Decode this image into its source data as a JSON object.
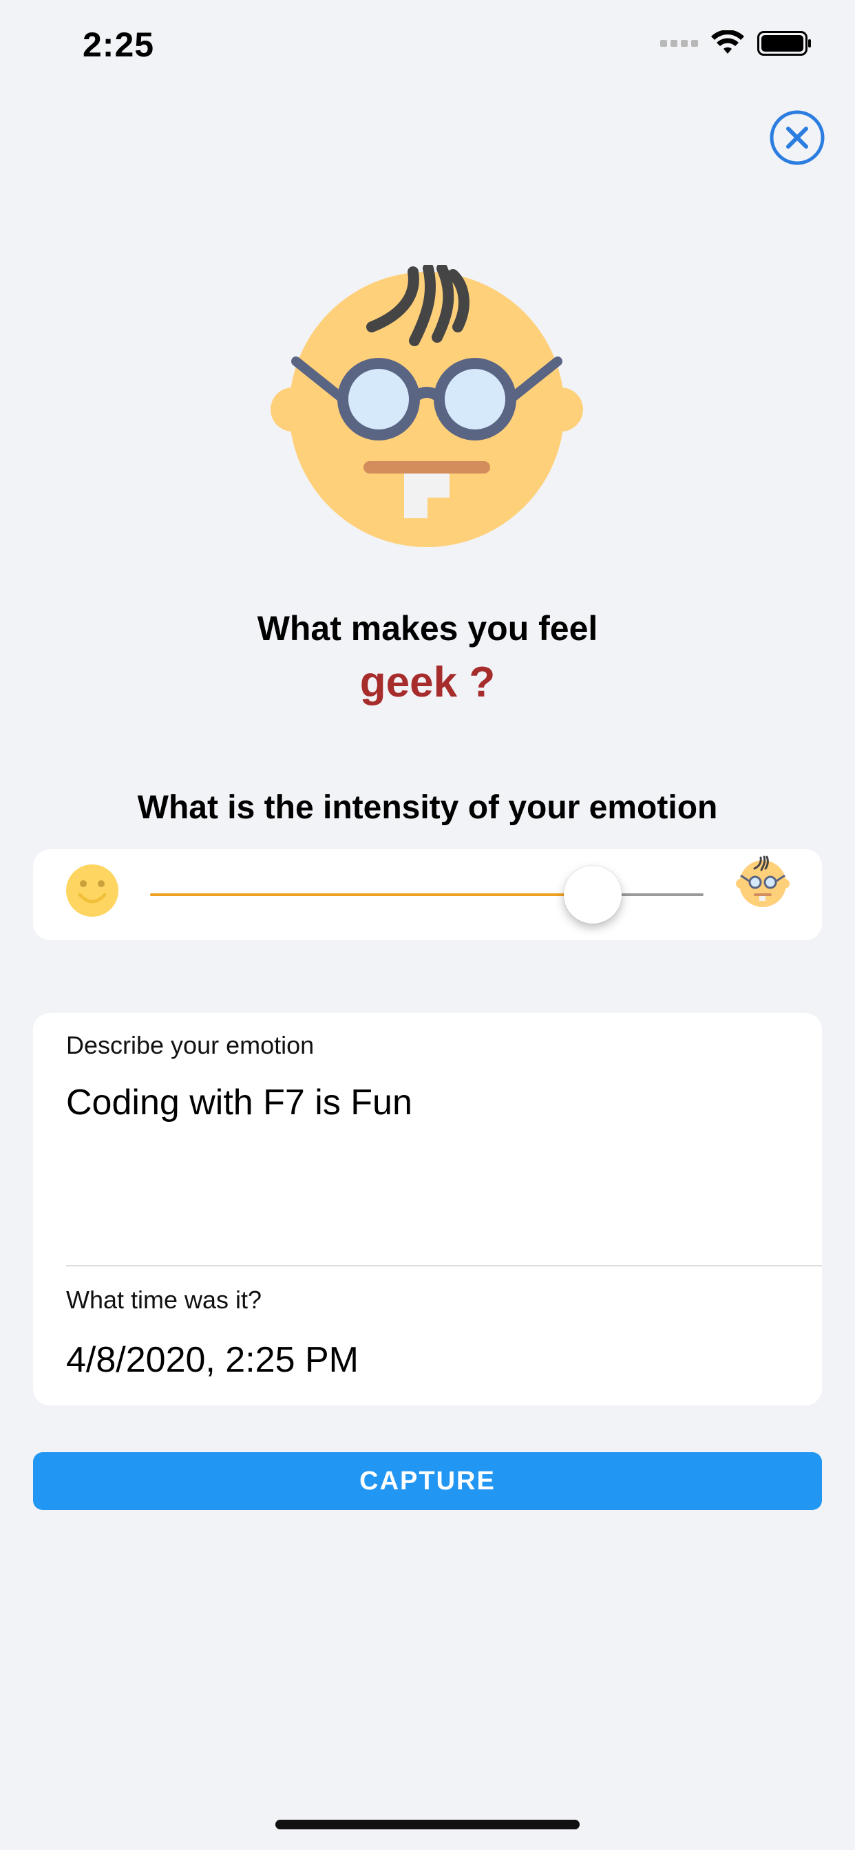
{
  "status_bar": {
    "time": "2:25"
  },
  "prompt": {
    "question": "What makes you feel",
    "emotion": "geek ?"
  },
  "intensity": {
    "title": "What is the intensity of your emotion",
    "value_fraction": 0.8
  },
  "form": {
    "describe_label": "Describe your emotion",
    "describe_value": "Coding with F7 is Fun",
    "time_label": "What time was it?",
    "time_value": "4/8/2020, 2:25 PM"
  },
  "capture_button": {
    "label": "CAPTURE"
  },
  "icons": {
    "close": "close-circle-icon",
    "hero": "geek-face-icon",
    "slider_min": "smiley-face-icon",
    "slider_max": "geek-face-icon"
  },
  "colors": {
    "accent": "#2196f3",
    "emotion": "#a72c2c",
    "slider_fill": "#f0a020",
    "face": "#ffd07a"
  }
}
